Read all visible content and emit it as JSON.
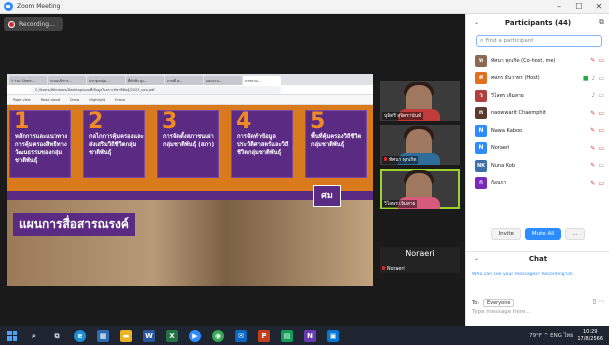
{
  "window": {
    "title": "Zoom Meeting",
    "controls": [
      "–",
      "☐",
      "✕"
    ]
  },
  "recording": {
    "label": "Recording..."
  },
  "browser": {
    "tabs": [
      "Y ร่วม Share...",
      "ระบบบริหาร...",
      "ประชุมกลุ่ม...",
      "ที่พักพิง สูง...",
      "ภาพที่ ๒...",
      "แผนงาน...",
      "ภาพรวม..."
    ],
    "url": "C:/Users/Windows/Desktop/แผนที่/ข้อมูลวิเคราะห์ชาติพันธุ์/2023_แผน.pdf",
    "toolbar": [
      "Page view",
      "Read aloud",
      "Draw",
      "Highlight",
      "Erase"
    ]
  },
  "slide": {
    "cards": [
      {
        "num": "1",
        "text": "หลักการและแนวทางการคุ้มครองสิทธิทางวัฒนธรรมของกลุ่มชาติพันธุ์"
      },
      {
        "num": "2",
        "text": "กลไกการคุ้มครองและส่งเสริมวิถีชีวิตกลุ่มชาติพันธุ์"
      },
      {
        "num": "3",
        "text": "การจัดตั้งสภาชนเผ่ากลุ่มชาติพันธุ์ (สภา)"
      },
      {
        "num": "4",
        "text": "การจัดทำข้อมูลประวัติศาสตร์และวิถีชีวิตกลุ่มชาติพันธุ์"
      },
      {
        "num": "5",
        "text": "พื้นที่คุ้มครองวิถีชีวิตกลุ่มชาติพันธุ์"
      }
    ],
    "logo": "ศม",
    "headline": "แผนการสื่อสารณรงค์"
  },
  "video_tiles": [
    {
      "name": "นุจิตรี สุจิตรานันท์"
    },
    {
      "name": "ทัศนา พุกเกิด"
    },
    {
      "name": "วิไลพร เจิมสาย"
    }
  ],
  "active_speaker": {
    "display": "Noraeri",
    "label": "Noraeri"
  },
  "participants_panel": {
    "title": "Participants (44)",
    "search_placeholder": "Find a participant",
    "items": [
      {
        "initial": "ท",
        "name": "ทัศนา พุกเกิด (Co-host, me)",
        "color": "#8a6a52",
        "status": [
          "mic-off",
          "cam-off"
        ]
      },
      {
        "initial": "ศ",
        "name": "ศสภร ธันวาทร (Host)",
        "color": "#e07020",
        "status": [
          "share",
          "mic-on",
          "cam-on"
        ]
      },
      {
        "initial": "ว",
        "name": "วิไลพร เจิมสาย",
        "color": "#b04040",
        "status": [
          "mic-on",
          "cam-on"
        ]
      },
      {
        "initial": "n",
        "name": "naowwarit Chaemphit",
        "color": "#5a3a2a",
        "status": [
          "mic-off",
          "cam-off"
        ]
      },
      {
        "initial": "N",
        "name": "Nawa Kaboo",
        "color": "#2d8cff",
        "status": [
          "mic-off",
          "cam-off"
        ]
      },
      {
        "initial": "N",
        "name": "Noraeri",
        "color": "#2d8cff",
        "status": [
          "mic-off",
          "cam-off"
        ]
      },
      {
        "initial": "NK",
        "name": "Nuna Kob",
        "color": "#3d6fa8",
        "status": [
          "mic-off",
          "cam-on"
        ]
      },
      {
        "initial": "ก",
        "name": "ก้อนกา",
        "color": "#7a2ab8",
        "status": [
          "mic-off",
          "cam-off"
        ]
      }
    ],
    "invite_label": "Invite",
    "mute_all_label": "Mute All",
    "more_label": "..."
  },
  "chat": {
    "title": "Chat",
    "notice": "Who can see your messages? Recording On",
    "to_label": "To:",
    "to_value": "Everyone",
    "input_placeholder": "Type message here..."
  },
  "taskbar": {
    "apps": [
      "search",
      "task-view",
      "edge",
      "store",
      "files",
      "word",
      "excel",
      "zoom",
      "chrome",
      "mail",
      "powerpoint",
      "sheets",
      "outlook",
      "photos"
    ],
    "tray": "79°F  ^  ENG  ไทย",
    "time": "10:29",
    "date": "17/8/2566"
  },
  "colors": {
    "slide_orange": "#d97a1c",
    "slide_purple": "#5b2a82",
    "zoom_blue": "#2d8cff",
    "mute_red": "#e02828",
    "active_border": "#9bd32e"
  }
}
